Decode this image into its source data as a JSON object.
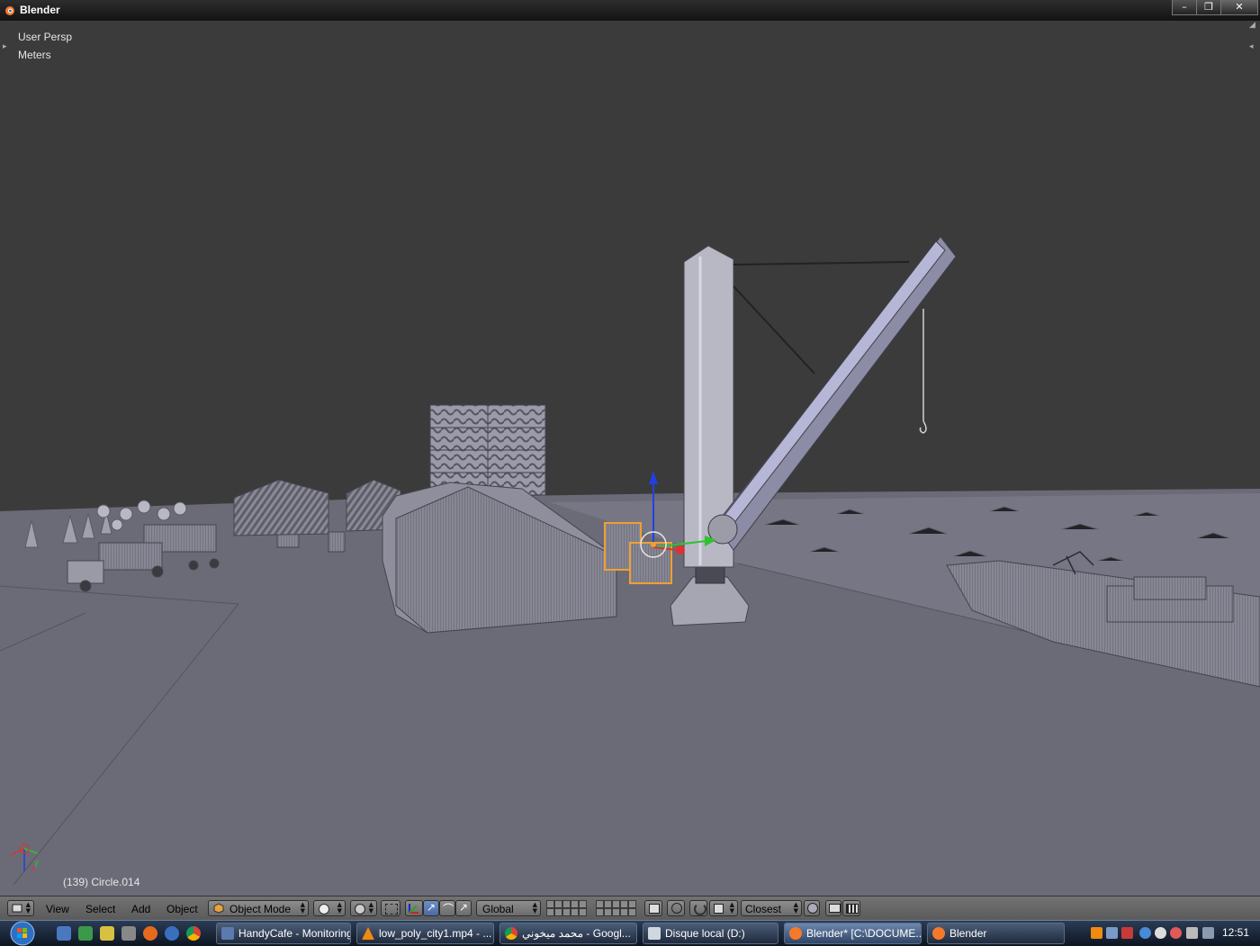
{
  "window": {
    "title": "Blender",
    "buttons": [
      "minimize",
      "restore",
      "close"
    ]
  },
  "viewport": {
    "view_label": "User Persp",
    "units_label": "Meters",
    "object_info": "(139) Circle.014"
  },
  "header": {
    "menus": {
      "view": "View",
      "select": "Select",
      "add": "Add",
      "object": "Object"
    },
    "mode": "Object Mode",
    "orientation": "Global",
    "snap_target": "Closest"
  },
  "taskbar": {
    "tasks": [
      {
        "label": "HandyCafe - Monitoring",
        "icon": "handycafe-icon",
        "active": false
      },
      {
        "label": "low_poly_city1.mp4 - ...",
        "icon": "vlc-icon",
        "active": false
      },
      {
        "label": "محمد ميخوني - Googl...",
        "icon": "chrome-icon",
        "active": false
      },
      {
        "label": "Disque local (D:)",
        "icon": "folder-icon",
        "active": false
      },
      {
        "label": "Blender* [C:\\DOCUME...",
        "icon": "blender-icon",
        "active": true
      },
      {
        "label": "Blender",
        "icon": "blender-icon",
        "active": false
      }
    ],
    "clock": "12:51"
  },
  "colors": {
    "viewport_bg": "#3b3b3b",
    "ground": "#6b6b78",
    "selection": "#f0a030",
    "axis_x": "#e03030",
    "axis_y": "#30c030",
    "axis_z": "#2040e0"
  }
}
